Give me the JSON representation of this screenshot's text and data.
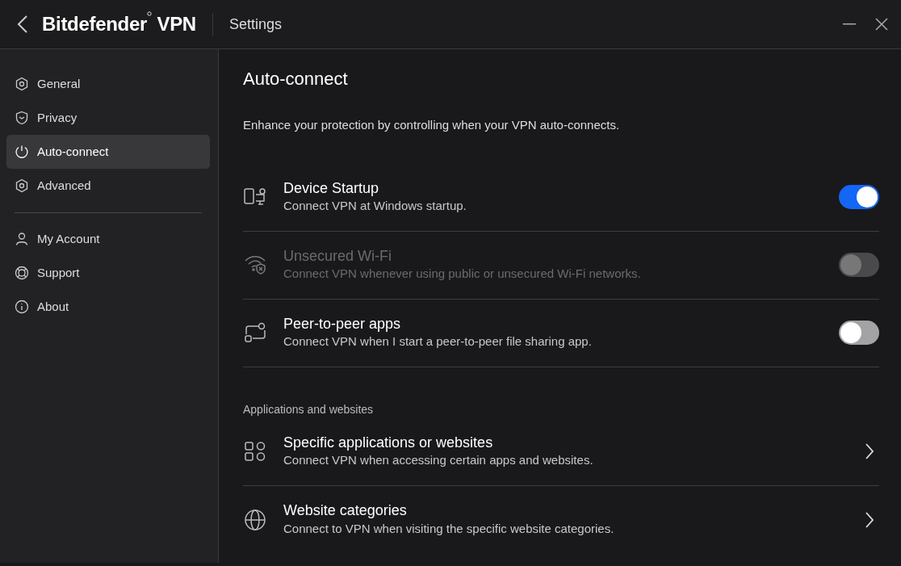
{
  "window": {
    "app_name": "Bitdefender",
    "app_suffix": "VPN",
    "title": "Settings"
  },
  "sidebar": {
    "sections": [
      {
        "items": [
          {
            "label": "General",
            "selected": false
          },
          {
            "label": "Privacy",
            "selected": false
          },
          {
            "label": "Auto-connect",
            "selected": true
          },
          {
            "label": "Advanced",
            "selected": false
          }
        ]
      },
      {
        "items": [
          {
            "label": "My Account",
            "selected": false
          },
          {
            "label": "Support",
            "selected": false
          },
          {
            "label": "About",
            "selected": false
          }
        ]
      }
    ]
  },
  "page": {
    "heading": "Auto-connect",
    "description": "Enhance your protection by controlling when your VPN auto-connects.",
    "groups": [
      {
        "rows": [
          {
            "kind": "toggle",
            "title": "Device Startup",
            "subtitle": "Connect VPN at Windows startup.",
            "on": true,
            "disabled": false
          },
          {
            "kind": "toggle",
            "title": "Unsecured Wi-Fi",
            "subtitle": "Connect VPN whenever using public or unsecured Wi-Fi networks.",
            "on": false,
            "disabled": true
          },
          {
            "kind": "toggle",
            "title": "Peer-to-peer apps",
            "subtitle": "Connect VPN when I start a peer-to-peer file sharing app.",
            "on": false,
            "disabled": false
          }
        ]
      },
      {
        "heading": "Applications and websites",
        "rows": [
          {
            "kind": "link",
            "title": "Specific applications or websites",
            "subtitle": "Connect VPN when accessing certain apps and websites."
          },
          {
            "kind": "link",
            "title": "Website categories",
            "subtitle": "Connect to VPN when visiting the specific website categories."
          }
        ]
      }
    ]
  }
}
